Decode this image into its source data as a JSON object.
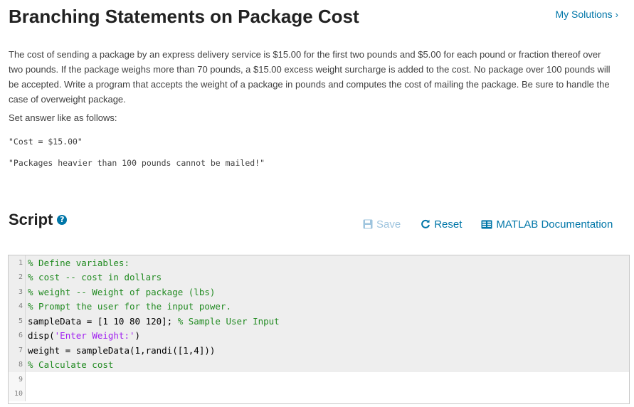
{
  "header": {
    "title": "Branching Statements on Package Cost",
    "my_solutions": "My Solutions"
  },
  "problem": {
    "description": "The cost of sending a package by an express delivery service is $15.00 for the first two pounds and $5.00 for each pound or fraction thereof over two pounds. If the package weighs more than 70 pounds, a $15.00 excess weight surcharge is added to the cost. No package over 100 pounds will be accepted. Write a program that accepts the weight of a package in pounds and computes the cost of mailing the package. Be sure to handle the case of overweight package.",
    "set_answer": "Set answer like as follows:",
    "example_1": "\"Cost = $15.00\"",
    "example_2": "\"Packages heavier than 100 pounds cannot be mailed!\""
  },
  "script": {
    "heading": "Script",
    "toolbar": {
      "save": "Save",
      "reset": "Reset",
      "docs": "MATLAB Documentation"
    },
    "lines": [
      {
        "num": "1",
        "parts": [
          {
            "t": "% Define variables:",
            "c": "cmt"
          }
        ]
      },
      {
        "num": "2",
        "parts": [
          {
            "t": "% cost -- cost in dollars",
            "c": "cmt"
          }
        ]
      },
      {
        "num": "3",
        "parts": [
          {
            "t": "% weight -- Weight of package (lbs)",
            "c": "cmt"
          }
        ]
      },
      {
        "num": "4",
        "parts": [
          {
            "t": "% Prompt the user for the input power.",
            "c": "cmt"
          }
        ]
      },
      {
        "num": "5",
        "parts": [
          {
            "t": "sampleData = [1 10 80 120]; ",
            "c": ""
          },
          {
            "t": "% Sample User Input",
            "c": "cmt"
          }
        ]
      },
      {
        "num": "6",
        "parts": [
          {
            "t": "disp(",
            "c": ""
          },
          {
            "t": "'Enter Weight:'",
            "c": "str"
          },
          {
            "t": ")",
            "c": ""
          }
        ]
      },
      {
        "num": "7",
        "parts": [
          {
            "t": "weight = sampleData(1,randi([1,4]))",
            "c": ""
          }
        ]
      },
      {
        "num": "8",
        "parts": [
          {
            "t": "% Calculate cost",
            "c": "cmt"
          }
        ]
      },
      {
        "num": "9",
        "parts": []
      },
      {
        "num": "10",
        "parts": []
      }
    ],
    "locked_lines": 8
  }
}
